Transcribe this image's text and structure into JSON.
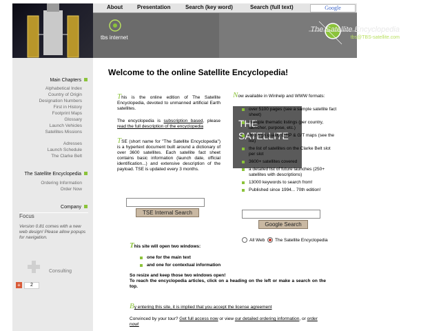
{
  "nav": {
    "about": "About",
    "presentation": "Presentation",
    "search_keyword": "Search (key word)",
    "search_fulltext": "Search (full text)"
  },
  "header": {
    "title": "The Satellite Encyclopedia",
    "email": "tbs@TBS-satellite.com",
    "logo_text": "tbs internet",
    "google_label": "Google"
  },
  "sidebar": {
    "main_chapters": "Main Chapters",
    "chapters": [
      "Alphabetical Index",
      "Country of Origin",
      "Designation Numbers",
      "First in History",
      "Footprint Maps",
      "Glossary",
      "Launch Vehicles",
      "Satellites Missions"
    ],
    "extras": [
      "Adresses",
      "Launch Schedule",
      "The Clarke Belt"
    ],
    "encyclopedia": "The Satellite Encyclopedia",
    "order_links": [
      "Ordering Information",
      "Order Now"
    ],
    "company": "Company",
    "focus_title": "Focus",
    "focus_text": "Version 0.81 comes with a new web design! Please allow popups for navigation.",
    "consulting": "Consulting",
    "share_count": "2"
  },
  "main": {
    "title": "Welcome to the online Satellite Encyclopedia!",
    "intro": "his is the online edition of The Satellite Encyclopedia, devoted to unmanned artificial Earth satellites.",
    "intro_initial": "T",
    "subscription_pre": "The encyclopedia is ",
    "subscription_link": "subscription based",
    "subscription_mid": ", please ",
    "subscription_link2": "read the full description of the encyclopedia",
    "tse_initial": "T",
    "tse_text": "SE (short name for \"The Satellite Encyclopedia\") is a hypertext document built around a dictionary of over 3600 satellites. Each satellite fact sheet contains basic information (launch date, official identification...) and extensive description of the payload. TSE is updated every 3 months.",
    "now_initial": "N",
    "now_text": "ow available in Winhelp and WWW formats:",
    "features": [
      "over 5100 pages (see a sample satellite fact sheet)",
      "multiple thematic listings (per country, launcher, purpose, etc.)",
      "800 high quality EIRP & G/T maps (see the list)",
      "the list of satellites on the Clarke Belt slot per slot",
      "3600+ satellites covered",
      "a detailed list of future launches (250+ satellites with descriptions)",
      "13000 keywords to search from!",
      "Published since 1994... 70th edition!"
    ],
    "tse_search_btn": "TSE Internal Search",
    "google_search_btn": "Google Search",
    "radio_web": "All Web",
    "radio_tse": "The Satellite Encyclopedia",
    "windows_initial": "T",
    "windows_text": "his site will open two windows:",
    "window_items": [
      "one for the main text",
      "and one for contextual information"
    ],
    "resize_text": "So resize and keep those two windows open!",
    "reach_text": "To reach the encyclopedia articles, click on a heading on the left or make a search on the top.",
    "license_initial": "B",
    "license_text": "y entering this site, it is implied that you accept the license agreement",
    "convinced_pre": "Convinced by your tour? ",
    "convinced_link1": "Get full access now",
    "convinced_mid": " or view ",
    "convinced_link2": "our detailed ordering information",
    "convinced_mid2": ", or ",
    "convinced_link3": "order now!"
  },
  "colors": {
    "accent": "#8bc33a",
    "header_gray": "#6d6d6d",
    "sidebar_bg": "#e9e9e9"
  }
}
